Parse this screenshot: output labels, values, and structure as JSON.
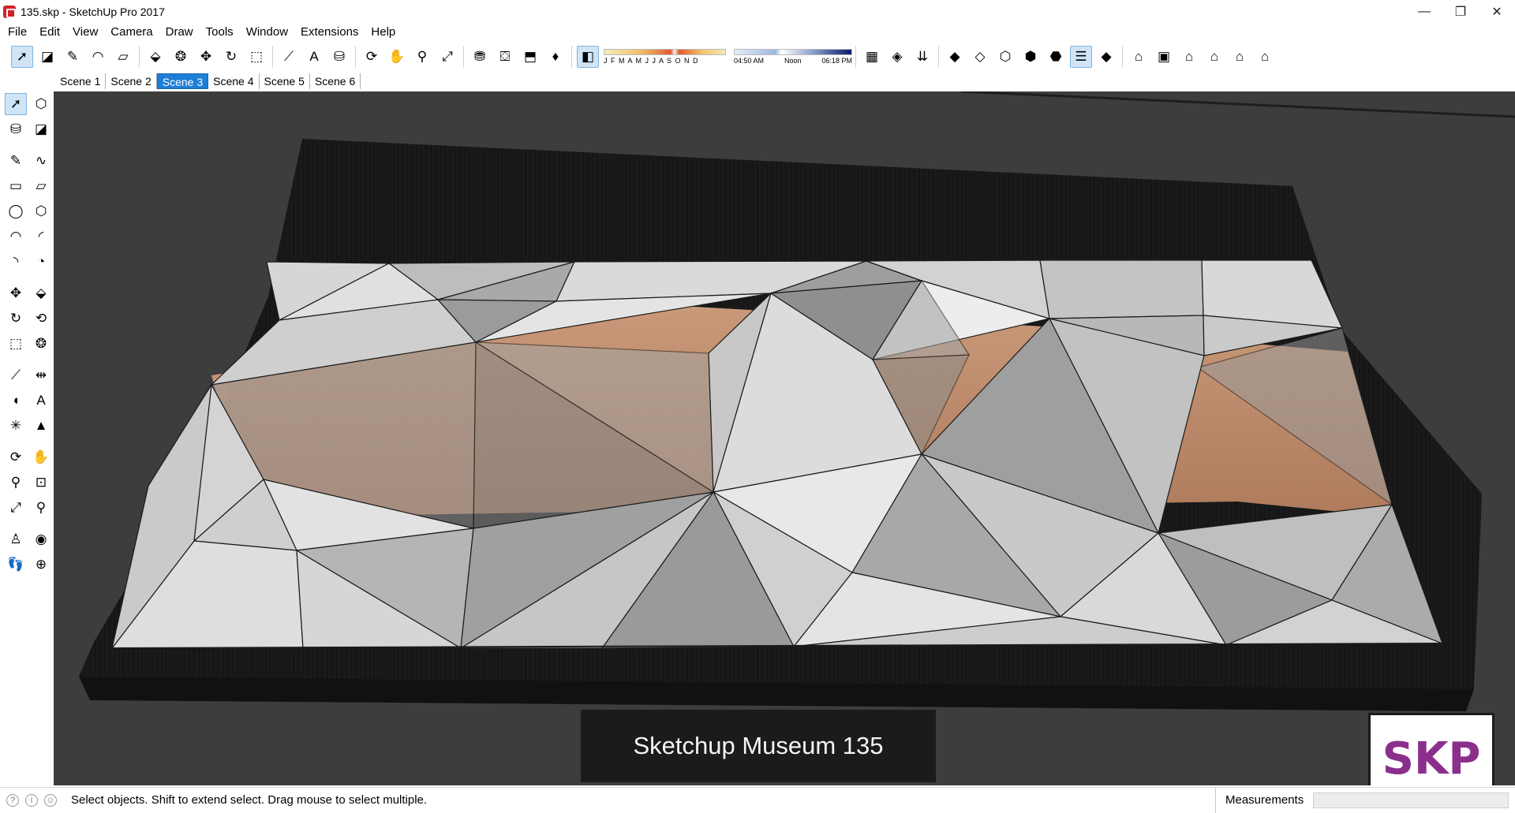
{
  "window": {
    "title": "135.skp - SketchUp Pro 2017",
    "minimize": "—",
    "maximize": "❐",
    "close": "✕"
  },
  "menu": [
    "File",
    "Edit",
    "View",
    "Camera",
    "Draw",
    "Tools",
    "Window",
    "Extensions",
    "Help"
  ],
  "toolbar": {
    "months": "J F M A M J J A S O N D",
    "time_start": "04:50 AM",
    "time_mid": "Noon",
    "time_end": "06:18 PM"
  },
  "scenes": [
    "Scene 1",
    "Scene 2",
    "Scene 3",
    "Scene 4",
    "Scene 5",
    "Scene 6"
  ],
  "active_scene": "Scene 3",
  "viewport": {
    "caption": "Sketchup Museum 135",
    "logo": "SKP"
  },
  "status": {
    "message": "Select objects. Shift to extend select. Drag mouse to select multiple.",
    "measurements_label": "Measurements",
    "measurements_value": ""
  },
  "colors": {
    "accent": "#1c7ed6",
    "viewport_bg": "#3d3d3d",
    "roof_light": "#d8d8d8",
    "roof_dark": "#8a8a8a",
    "glow": "#e0a27c"
  }
}
